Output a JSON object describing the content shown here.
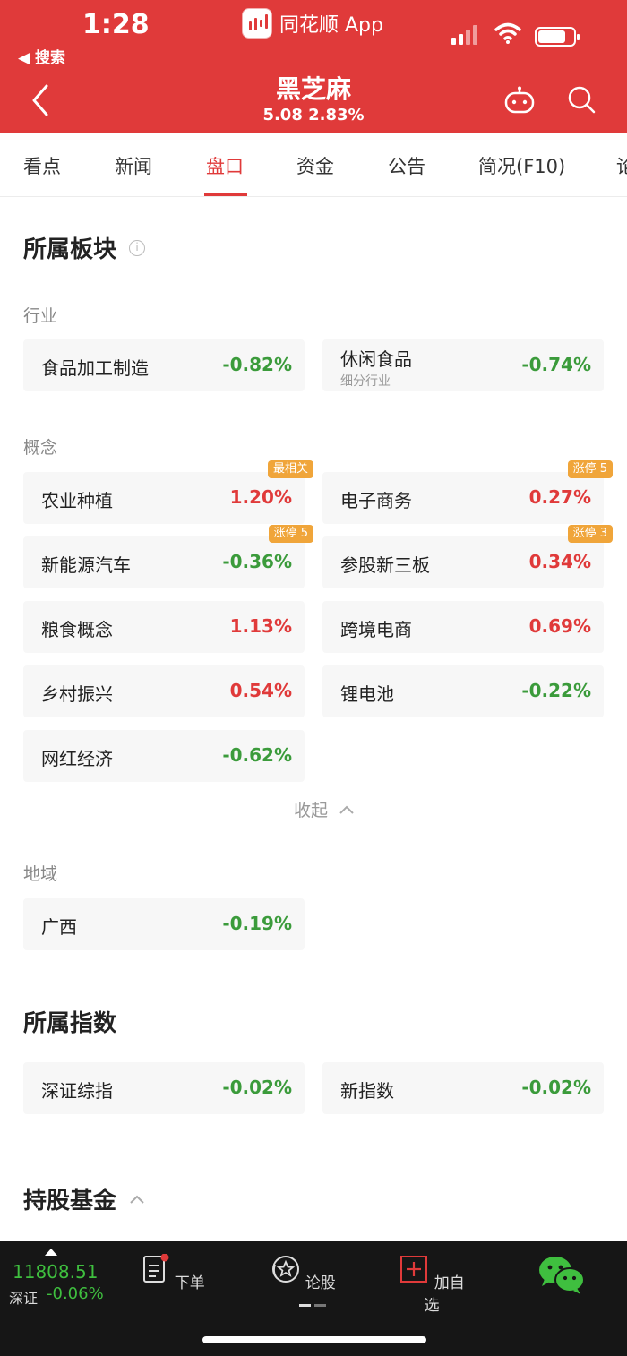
{
  "status": {
    "time": "1:28",
    "back_to": "◀ 搜索",
    "app_name": "同花顺 App"
  },
  "header": {
    "title": "黑芝麻",
    "subtitle": "5.08 2.83%"
  },
  "tabs": [
    "看点",
    "新闻",
    "盘口",
    "资金",
    "公告",
    "简况(F10)",
    "论"
  ],
  "sector": {
    "title": "所属板块",
    "industry_label": "行业",
    "industry": [
      {
        "name": "食品加工制造",
        "pct": "-0.82%",
        "dir": "down"
      },
      {
        "name": "休闲食品",
        "sub": "细分行业",
        "pct": "-0.74%",
        "dir": "down"
      }
    ],
    "concept_label": "概念",
    "concepts": [
      {
        "name": "农业种植",
        "pct": "1.20%",
        "dir": "up",
        "tag": "最相关"
      },
      {
        "name": "电子商务",
        "pct": "0.27%",
        "dir": "up",
        "tag": "涨停 5"
      },
      {
        "name": "新能源汽车",
        "pct": "-0.36%",
        "dir": "down",
        "tag": "涨停 5"
      },
      {
        "name": "参股新三板",
        "pct": "0.34%",
        "dir": "up",
        "tag": "涨停 3"
      },
      {
        "name": "粮食概念",
        "pct": "1.13%",
        "dir": "up"
      },
      {
        "name": "跨境电商",
        "pct": "0.69%",
        "dir": "up"
      },
      {
        "name": "乡村振兴",
        "pct": "0.54%",
        "dir": "up"
      },
      {
        "name": "锂电池",
        "pct": "-0.22%",
        "dir": "down"
      },
      {
        "name": "网红经济",
        "pct": "-0.62%",
        "dir": "down"
      }
    ],
    "collapse_label": "收起",
    "region_label": "地域",
    "region": [
      {
        "name": "广西",
        "pct": "-0.19%",
        "dir": "down"
      }
    ]
  },
  "indices": {
    "title": "所属指数",
    "items": [
      {
        "name": "深证综指",
        "pct": "-0.02%",
        "dir": "down"
      },
      {
        "name": "新指数",
        "pct": "-0.02%",
        "dir": "down"
      }
    ]
  },
  "funds": {
    "title": "持股基金"
  },
  "bottom": {
    "index_value": "11808.51",
    "index_name": "深证",
    "index_pct": "-0.06%",
    "nav": [
      "下单",
      "论股",
      "加自选"
    ]
  },
  "colors": {
    "brand_red": "#e03a3a",
    "up": "#e03a3a",
    "down": "#3b9b3b",
    "tag": "#f0a53a"
  }
}
